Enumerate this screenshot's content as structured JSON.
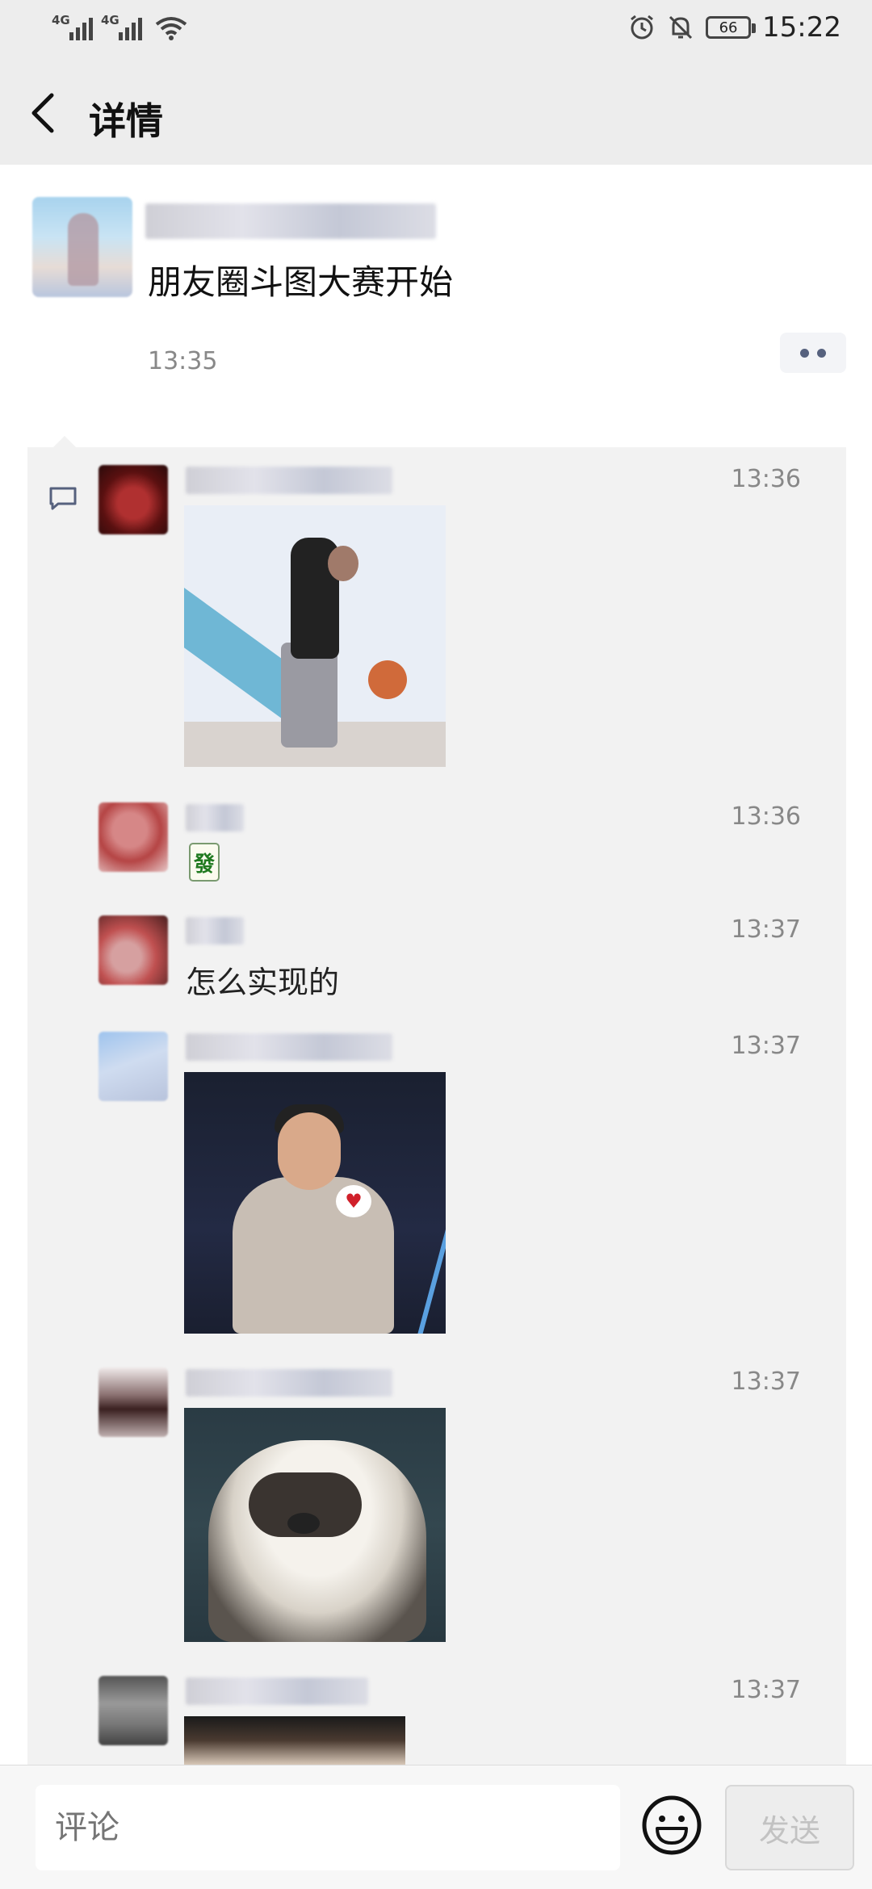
{
  "status_bar": {
    "sim1": "4G",
    "sim2": "4G",
    "battery": "66",
    "time": "15:22"
  },
  "title_bar": {
    "title": "详情"
  },
  "post": {
    "text": "朋友圈斗图大赛开始",
    "time": "13:35"
  },
  "comments": [
    {
      "time": "13:36",
      "type": "image"
    },
    {
      "time": "13:36",
      "type": "emoji",
      "content": "發"
    },
    {
      "time": "13:37",
      "type": "text",
      "content": "怎么实现的"
    },
    {
      "time": "13:37",
      "type": "image"
    },
    {
      "time": "13:37",
      "type": "image"
    },
    {
      "time": "13:37",
      "type": "image"
    }
  ],
  "input_bar": {
    "placeholder": "评论",
    "send_label": "发送"
  },
  "icons": {
    "back": "back-arrow-icon",
    "more": "more-dots-icon",
    "comment": "comment-icon",
    "emoji": "emoji-icon",
    "alarm": "alarm-icon",
    "mute": "bell-off-icon",
    "wifi": "wifi-icon"
  },
  "colors": {
    "background": "#ededed",
    "card": "#ffffff",
    "comment_area": "#f2f2f2",
    "link_dots": "#56617e"
  }
}
